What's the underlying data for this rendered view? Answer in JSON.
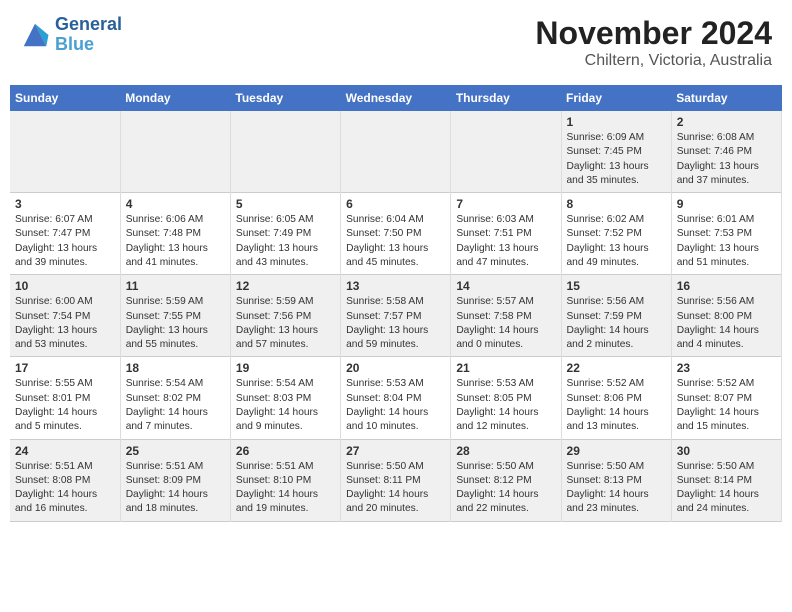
{
  "header": {
    "logo_line1": "General",
    "logo_line2": "Blue",
    "month_title": "November 2024",
    "subtitle": "Chiltern, Victoria, Australia"
  },
  "weekdays": [
    "Sunday",
    "Monday",
    "Tuesday",
    "Wednesday",
    "Thursday",
    "Friday",
    "Saturday"
  ],
  "weeks": [
    [
      {
        "day": "",
        "info": ""
      },
      {
        "day": "",
        "info": ""
      },
      {
        "day": "",
        "info": ""
      },
      {
        "day": "",
        "info": ""
      },
      {
        "day": "",
        "info": ""
      },
      {
        "day": "1",
        "info": "Sunrise: 6:09 AM\nSunset: 7:45 PM\nDaylight: 13 hours\nand 35 minutes."
      },
      {
        "day": "2",
        "info": "Sunrise: 6:08 AM\nSunset: 7:46 PM\nDaylight: 13 hours\nand 37 minutes."
      }
    ],
    [
      {
        "day": "3",
        "info": "Sunrise: 6:07 AM\nSunset: 7:47 PM\nDaylight: 13 hours\nand 39 minutes."
      },
      {
        "day": "4",
        "info": "Sunrise: 6:06 AM\nSunset: 7:48 PM\nDaylight: 13 hours\nand 41 minutes."
      },
      {
        "day": "5",
        "info": "Sunrise: 6:05 AM\nSunset: 7:49 PM\nDaylight: 13 hours\nand 43 minutes."
      },
      {
        "day": "6",
        "info": "Sunrise: 6:04 AM\nSunset: 7:50 PM\nDaylight: 13 hours\nand 45 minutes."
      },
      {
        "day": "7",
        "info": "Sunrise: 6:03 AM\nSunset: 7:51 PM\nDaylight: 13 hours\nand 47 minutes."
      },
      {
        "day": "8",
        "info": "Sunrise: 6:02 AM\nSunset: 7:52 PM\nDaylight: 13 hours\nand 49 minutes."
      },
      {
        "day": "9",
        "info": "Sunrise: 6:01 AM\nSunset: 7:53 PM\nDaylight: 13 hours\nand 51 minutes."
      }
    ],
    [
      {
        "day": "10",
        "info": "Sunrise: 6:00 AM\nSunset: 7:54 PM\nDaylight: 13 hours\nand 53 minutes."
      },
      {
        "day": "11",
        "info": "Sunrise: 5:59 AM\nSunset: 7:55 PM\nDaylight: 13 hours\nand 55 minutes."
      },
      {
        "day": "12",
        "info": "Sunrise: 5:59 AM\nSunset: 7:56 PM\nDaylight: 13 hours\nand 57 minutes."
      },
      {
        "day": "13",
        "info": "Sunrise: 5:58 AM\nSunset: 7:57 PM\nDaylight: 13 hours\nand 59 minutes."
      },
      {
        "day": "14",
        "info": "Sunrise: 5:57 AM\nSunset: 7:58 PM\nDaylight: 14 hours\nand 0 minutes."
      },
      {
        "day": "15",
        "info": "Sunrise: 5:56 AM\nSunset: 7:59 PM\nDaylight: 14 hours\nand 2 minutes."
      },
      {
        "day": "16",
        "info": "Sunrise: 5:56 AM\nSunset: 8:00 PM\nDaylight: 14 hours\nand 4 minutes."
      }
    ],
    [
      {
        "day": "17",
        "info": "Sunrise: 5:55 AM\nSunset: 8:01 PM\nDaylight: 14 hours\nand 5 minutes."
      },
      {
        "day": "18",
        "info": "Sunrise: 5:54 AM\nSunset: 8:02 PM\nDaylight: 14 hours\nand 7 minutes."
      },
      {
        "day": "19",
        "info": "Sunrise: 5:54 AM\nSunset: 8:03 PM\nDaylight: 14 hours\nand 9 minutes."
      },
      {
        "day": "20",
        "info": "Sunrise: 5:53 AM\nSunset: 8:04 PM\nDaylight: 14 hours\nand 10 minutes."
      },
      {
        "day": "21",
        "info": "Sunrise: 5:53 AM\nSunset: 8:05 PM\nDaylight: 14 hours\nand 12 minutes."
      },
      {
        "day": "22",
        "info": "Sunrise: 5:52 AM\nSunset: 8:06 PM\nDaylight: 14 hours\nand 13 minutes."
      },
      {
        "day": "23",
        "info": "Sunrise: 5:52 AM\nSunset: 8:07 PM\nDaylight: 14 hours\nand 15 minutes."
      }
    ],
    [
      {
        "day": "24",
        "info": "Sunrise: 5:51 AM\nSunset: 8:08 PM\nDaylight: 14 hours\nand 16 minutes."
      },
      {
        "day": "25",
        "info": "Sunrise: 5:51 AM\nSunset: 8:09 PM\nDaylight: 14 hours\nand 18 minutes."
      },
      {
        "day": "26",
        "info": "Sunrise: 5:51 AM\nSunset: 8:10 PM\nDaylight: 14 hours\nand 19 minutes."
      },
      {
        "day": "27",
        "info": "Sunrise: 5:50 AM\nSunset: 8:11 PM\nDaylight: 14 hours\nand 20 minutes."
      },
      {
        "day": "28",
        "info": "Sunrise: 5:50 AM\nSunset: 8:12 PM\nDaylight: 14 hours\nand 22 minutes."
      },
      {
        "day": "29",
        "info": "Sunrise: 5:50 AM\nSunset: 8:13 PM\nDaylight: 14 hours\nand 23 minutes."
      },
      {
        "day": "30",
        "info": "Sunrise: 5:50 AM\nSunset: 8:14 PM\nDaylight: 14 hours\nand 24 minutes."
      }
    ]
  ]
}
